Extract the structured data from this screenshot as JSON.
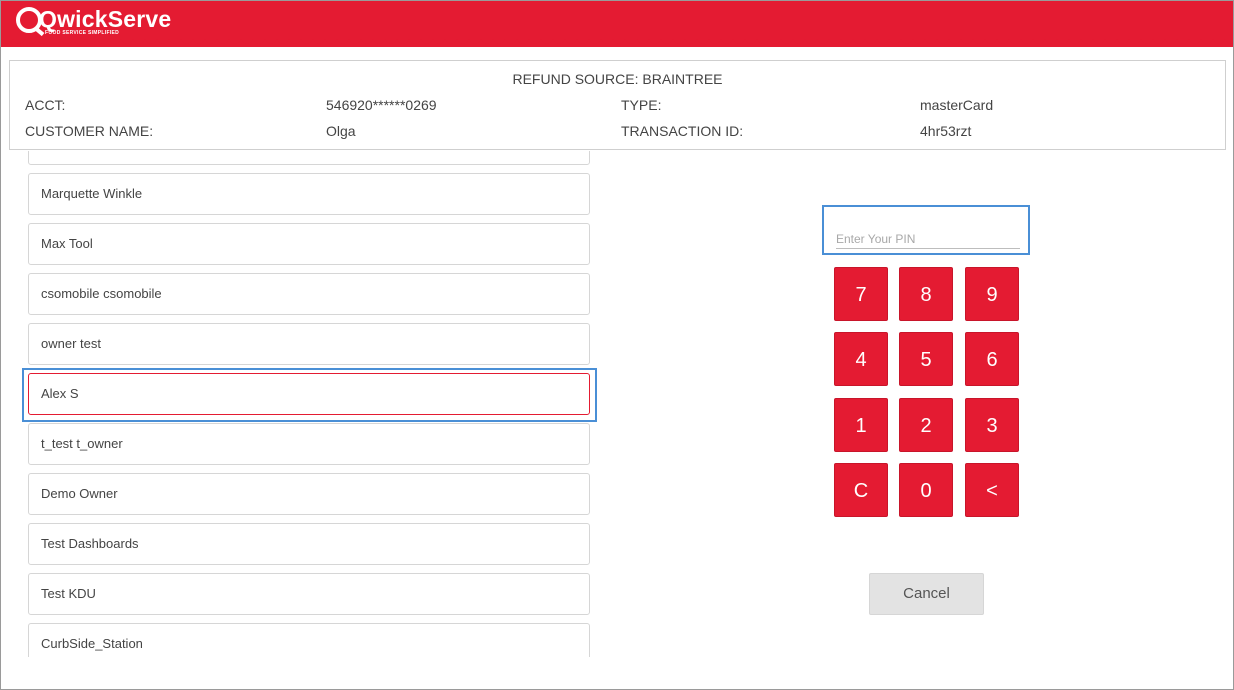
{
  "app": {
    "logo_text": "QwickServe",
    "logo_tagline": "FOOD SERVICE SIMPLIFIED",
    "brand_color": "#e41b32"
  },
  "refund": {
    "source": "REFUND SOURCE: BRAINTREE",
    "acct_label": "ACCT:",
    "acct_value": "546920******0269",
    "type_label": "TYPE:",
    "type_value": "masterCard",
    "customer_label": "CUSTOMER NAME:",
    "customer_value": "Olga",
    "txn_label": "TRANSACTION ID:",
    "txn_value": "4hr53rzt"
  },
  "employees": [
    {
      "label": ""
    },
    {
      "label": "Marquette Winkle"
    },
    {
      "label": "Max Tool"
    },
    {
      "label": "csomobile csomobile"
    },
    {
      "label": "owner test"
    },
    {
      "label": "Alex S",
      "selected": true
    },
    {
      "label": "t_test t_owner"
    },
    {
      "label": "Demo Owner"
    },
    {
      "label": "Test Dashboards"
    },
    {
      "label": "Test KDU"
    },
    {
      "label": "CurbSide_Station"
    }
  ],
  "pin": {
    "placeholder": "Enter Your PIN",
    "value": ""
  },
  "keypad": [
    "7",
    "8",
    "9",
    "4",
    "5",
    "6",
    "1",
    "2",
    "3",
    "C",
    "0",
    "<"
  ],
  "cancel_label": "Cancel",
  "highlight_color": "#4a8fd6"
}
